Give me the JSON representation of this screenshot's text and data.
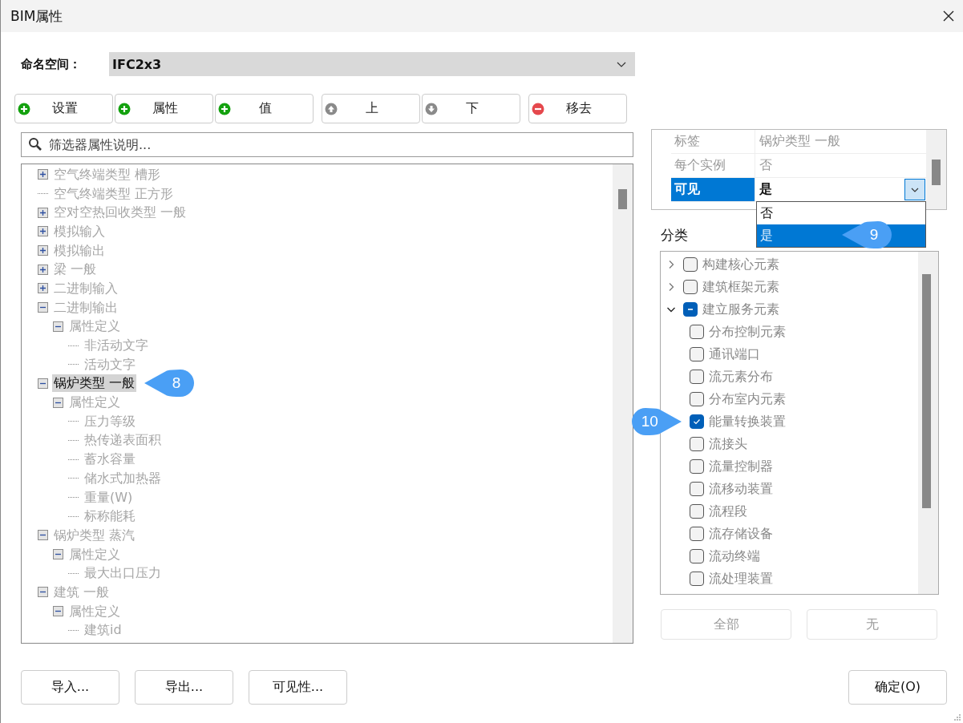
{
  "window": {
    "title": "BIM属性"
  },
  "namespace": {
    "label": "命名空间：",
    "value": "IFC2x3"
  },
  "toolbar": [
    [
      {
        "label": "设置",
        "kind": "add"
      },
      {
        "label": "属性",
        "kind": "add"
      },
      {
        "label": "值",
        "kind": "add"
      }
    ],
    [
      {
        "label": "上",
        "kind": "up"
      },
      {
        "label": "下",
        "kind": "down"
      }
    ],
    [
      {
        "label": "移去",
        "kind": "remove"
      }
    ]
  ],
  "search": {
    "placeholder": "筛选器属性说明..."
  },
  "tree": [
    {
      "label": "空气终端类型 槽形",
      "expanded": false,
      "selected": false
    },
    {
      "label": "空气终端类型 正方形",
      "selected": false
    },
    {
      "label": "空对空热回收类型 一般",
      "expanded": false,
      "selected": false
    },
    {
      "label": "模拟输入",
      "expanded": false,
      "selected": false
    },
    {
      "label": "模拟输出",
      "expanded": false,
      "selected": false
    },
    {
      "label": "梁 一般",
      "expanded": false,
      "selected": false
    },
    {
      "label": "二进制输入",
      "expanded": false,
      "selected": false
    },
    {
      "label": "二进制输出",
      "expanded": true,
      "selected": false,
      "children": [
        {
          "label": "属性定义",
          "expanded": true,
          "selected": false,
          "children": [
            {
              "label": "非活动文字",
              "selected": false
            },
            {
              "label": "活动文字",
              "selected": false
            }
          ]
        }
      ]
    },
    {
      "label": "锅炉类型 一般",
      "expanded": true,
      "selected": true,
      "callout": "8",
      "children": [
        {
          "label": "属性定义",
          "expanded": true,
          "selected": false,
          "children": [
            {
              "label": "压力等级",
              "selected": false
            },
            {
              "label": "热传递表面积",
              "selected": false
            },
            {
              "label": "蓄水容量",
              "selected": false
            },
            {
              "label": "储水式加热器",
              "selected": false
            },
            {
              "label": "重量(W)",
              "selected": false
            },
            {
              "label": "标称能耗",
              "selected": false
            }
          ]
        }
      ]
    },
    {
      "label": "锅炉类型 蒸汽",
      "expanded": true,
      "selected": false,
      "children": [
        {
          "label": "属性定义",
          "expanded": true,
          "selected": false,
          "children": [
            {
              "label": "最大出口压力",
              "selected": false
            }
          ]
        }
      ]
    },
    {
      "label": "建筑 一般",
      "expanded": true,
      "selected": false,
      "children": [
        {
          "label": "属性定义",
          "expanded": true,
          "selected": false,
          "children": [
            {
              "label": "建筑id",
              "selected": false
            }
          ]
        }
      ]
    }
  ],
  "properties": [
    {
      "name": "标签",
      "value": "锅炉类型 一般",
      "selected": false,
      "kind": "text"
    },
    {
      "name": "每个实例",
      "value": "否",
      "selected": false,
      "kind": "text"
    },
    {
      "name": "可见",
      "value": "是",
      "selected": true,
      "kind": "dropdown",
      "options": [
        {
          "label": "否",
          "selected": false
        },
        {
          "label": "是",
          "selected": true,
          "callout": "9"
        }
      ]
    }
  ],
  "classification": {
    "label": "分类",
    "items": [
      {
        "label": "构建核心元素",
        "expanded": false,
        "checked": false
      },
      {
        "label": "建筑框架元素",
        "expanded": false,
        "checked": false
      },
      {
        "label": "建立服务元素",
        "expanded": true,
        "indeterminate": true,
        "children": [
          {
            "label": "分布控制元素",
            "checked": false
          },
          {
            "label": "通讯端口",
            "checked": false
          },
          {
            "label": "流元素分布",
            "checked": false
          },
          {
            "label": "分布室内元素",
            "checked": false
          },
          {
            "label": "能量转换装置",
            "checked": true,
            "callout": "10"
          },
          {
            "label": "流接头",
            "checked": false
          },
          {
            "label": "流量控制器",
            "checked": false
          },
          {
            "label": "流移动装置",
            "checked": false
          },
          {
            "label": "流程段",
            "checked": false
          },
          {
            "label": "流存储设备",
            "checked": false
          },
          {
            "label": "流动终端",
            "checked": false
          },
          {
            "label": "流处理装置",
            "checked": false
          }
        ]
      }
    ],
    "buttons": [
      {
        "label": "全部",
        "disabled": true
      },
      {
        "label": "无",
        "disabled": true
      }
    ]
  },
  "footer": {
    "buttons": [
      {
        "label": "导入..."
      },
      {
        "label": "导出..."
      },
      {
        "label": "可见性..."
      }
    ],
    "ok": {
      "label": "确定(O)"
    }
  }
}
